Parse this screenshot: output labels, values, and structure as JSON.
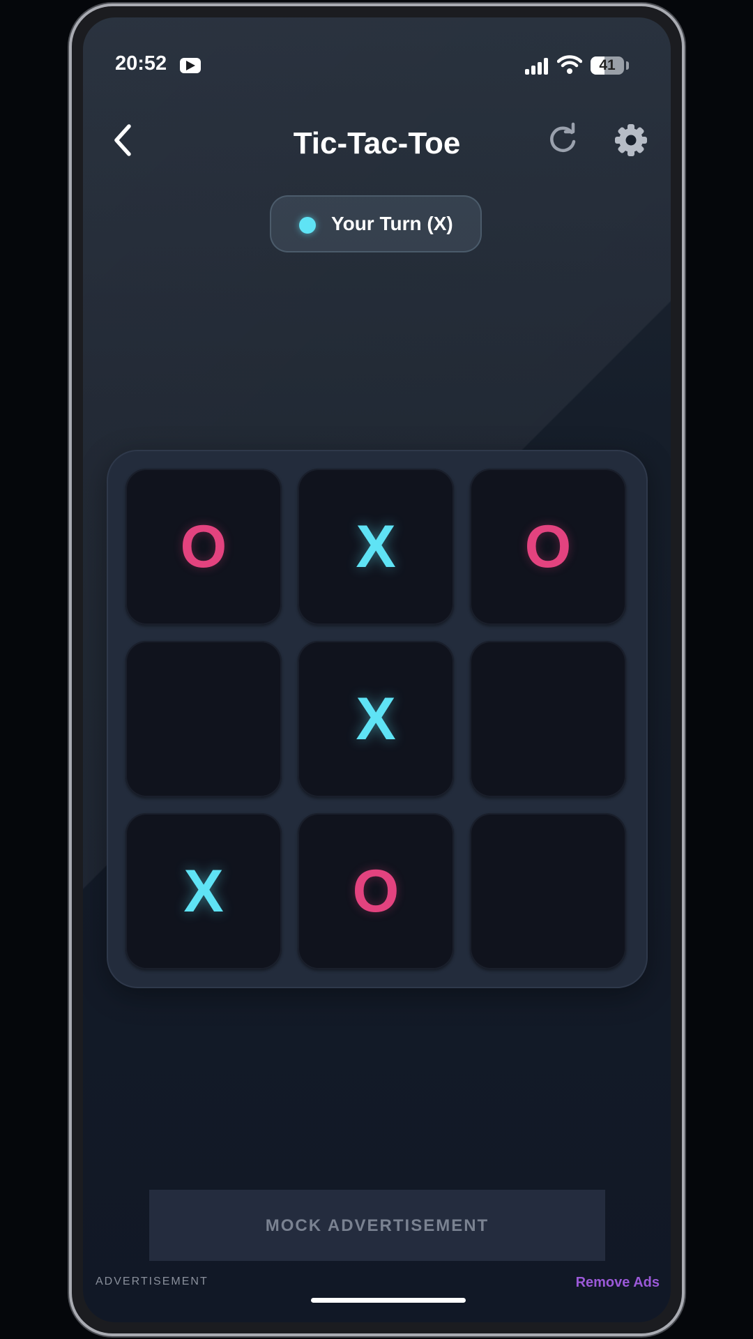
{
  "status_bar": {
    "time": "20:52",
    "battery_level": "41",
    "notification_icon": "youtube-icon"
  },
  "header": {
    "title": "Tic-Tac-Toe",
    "back_icon": "chevron-left-icon",
    "refresh_icon": "refresh-icon",
    "settings_icon": "gear-icon"
  },
  "turn_indicator": {
    "label": "Your Turn (X)"
  },
  "board": {
    "cells": [
      "O",
      "X",
      "O",
      "",
      "X",
      "",
      "X",
      "O",
      ""
    ]
  },
  "ad": {
    "banner_text": "MOCK ADVERTISEMENT",
    "caption": "ADVERTISEMENT",
    "remove_label": "Remove Ads"
  },
  "colors": {
    "x_color": "#5fe3f5",
    "o_color": "#e3437f",
    "accent_purple": "#9b59d8"
  }
}
